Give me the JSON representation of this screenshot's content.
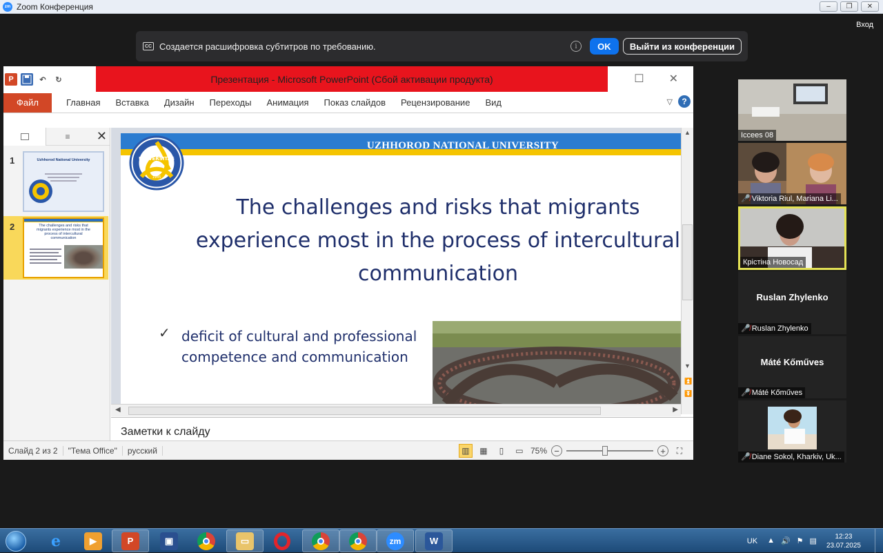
{
  "zoom": {
    "window_title": "Zoom Конференция",
    "caption_banner_text": "Создается расшифровка субтитров по требованию.",
    "ok_label": "OK",
    "leave_label": "Выйти из конференции",
    "signin_label": "Вход",
    "cc_label": "CC",
    "info_icon": "info-icon"
  },
  "ppt": {
    "title": "Презентация  -  Microsoft PowerPoint (Сбой активации продукта)",
    "file_tab": "Файл",
    "tabs": [
      "Главная",
      "Вставка",
      "Дизайн",
      "Переходы",
      "Анимация",
      "Показ слайдов",
      "Рецензирование",
      "Вид"
    ],
    "thumbnails": [
      {
        "number": "1",
        "mini_title": "Uzhhorod  National  University",
        "mini_text": "",
        "selected": false
      },
      {
        "number": "2",
        "mini_title": "The challenges and risks that migrants experience most in the process of intercultural communication",
        "mini_text": "",
        "selected": true
      }
    ],
    "slide": {
      "header": "UZHHOROD NATIONAL UNIVERSITY",
      "title_lines": [
        "The challenges and risks that migrants",
        "experience most in the process of intercultural",
        "communication"
      ],
      "check_mark": "✓",
      "bullet": "deficit of cultural and professional competence and communication",
      "logo_text": "UNIVERSITAS",
      "logo_year": "1945"
    },
    "notes_placeholder": "Заметки к слайду",
    "status": {
      "slide_counter": "Слайд 2 из 2",
      "theme": "\"Тема Office\"",
      "language": "русский",
      "zoom": "75%"
    }
  },
  "participants": [
    {
      "name": "Iccees 08",
      "has_video": true,
      "muted": false
    },
    {
      "name": "Viktoria Riul, Mariana Li...",
      "has_video": true,
      "muted": true
    },
    {
      "name": "Крістіна Новосад",
      "has_video": true,
      "muted": false,
      "active_speaker": true
    },
    {
      "name": "Ruslan Zhylenko",
      "display_name": "Ruslan Zhylenko",
      "has_video": false,
      "muted": true
    },
    {
      "name": "Máté Kőműves",
      "display_name": "Máté Kőműves",
      "has_video": false,
      "muted": true
    },
    {
      "name": "Diane Sokol, Kharkiv, Uk...",
      "has_video": false,
      "muted": true
    }
  ],
  "taskbar": {
    "apps": [
      "windows-start",
      "internet-explorer",
      "media-player",
      "powerpoint",
      "floppy-save",
      "chrome",
      "file-explorer",
      "opera",
      "chrome-profile-1",
      "chrome-profile-2",
      "zoom",
      "word"
    ],
    "language": "UK",
    "time": "12:23",
    "date": "23.07.2025",
    "zoom_label": "zm",
    "word_label": "W"
  },
  "colors": {
    "zoom_blue": "#0e72ed",
    "ppt_red": "#e8141d",
    "file_tab": "#d24726",
    "slide_blue": "#2b7cd0",
    "slide_yellow": "#f5c400",
    "slide_text": "#1f2f6b",
    "active_speaker": "#e4e255",
    "muted_red": "#e5383b"
  }
}
